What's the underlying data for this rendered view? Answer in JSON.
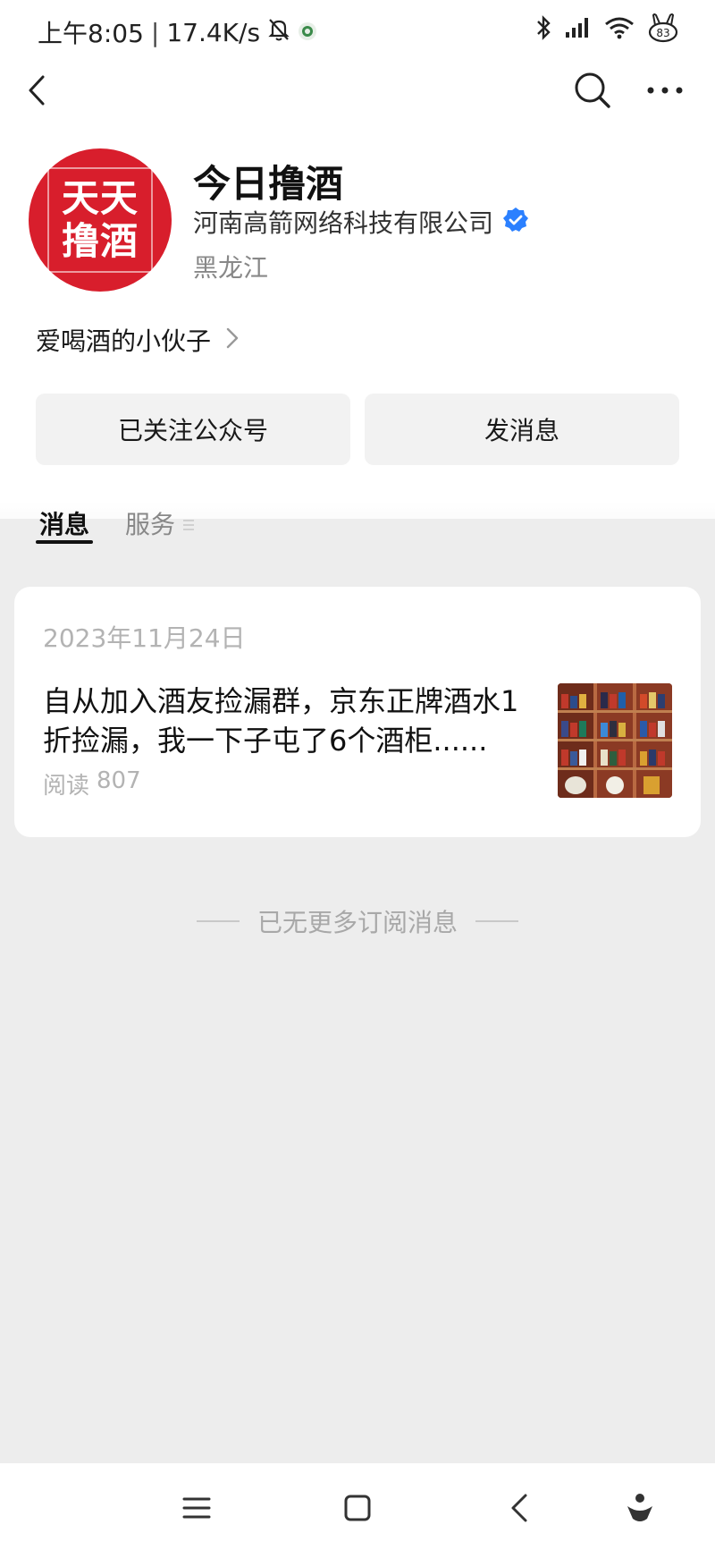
{
  "status_bar": {
    "time": "上午8:05",
    "separator": "|",
    "network_speed": "17.4K/s",
    "battery": "83"
  },
  "nav": {
    "back_icon": "chevron-left-icon",
    "search_icon": "search-icon",
    "more_icon": "more-horizontal-icon"
  },
  "profile": {
    "avatar_line1": "天天",
    "avatar_line2": "撸酒",
    "avatar_color": "#d81e2c",
    "name": "今日撸酒",
    "company": "河南高箭网络科技有限公司",
    "verified_color": "#2b80ff",
    "location": "黑龙江",
    "intro": "爱喝酒的小伙子"
  },
  "actions": {
    "follow_label": "已关注公众号",
    "message_label": "发消息"
  },
  "tabs": {
    "messages": "消息",
    "services": "服务"
  },
  "feed": {
    "date": "2023年11月24日",
    "article_title": "自从加入酒友捡漏群，京东正牌酒水1折捡漏，我一下子屯了6个酒柜......",
    "read_label": "阅读",
    "read_count": "807"
  },
  "end_text": "已无更多订阅消息"
}
